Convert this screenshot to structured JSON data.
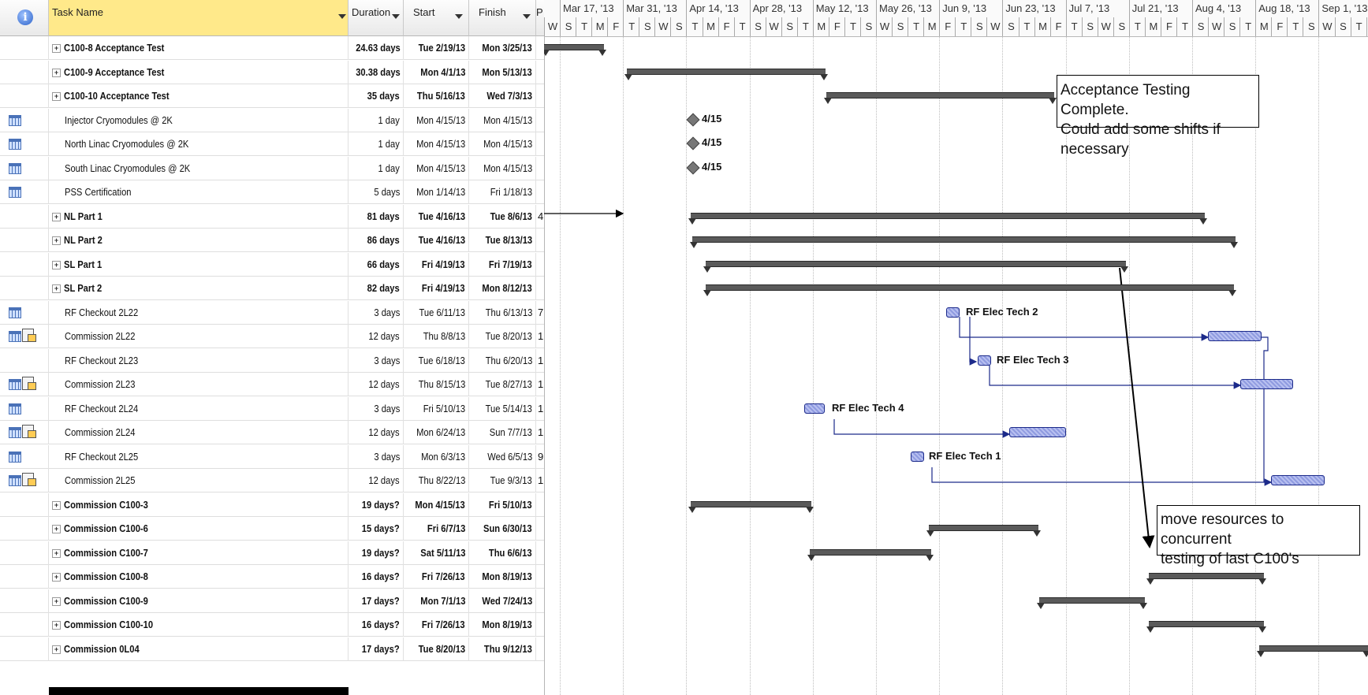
{
  "header": {
    "task_name": "Task Name",
    "duration": "Duration",
    "start": "Start",
    "finish": "Finish",
    "pred": "P"
  },
  "timescale": {
    "weeks": [
      "Mar 17, '13",
      "Mar 31, '13",
      "Apr 14, '13",
      "Apr 28, '13",
      "May 12, '13",
      "May 26, '13",
      "Jun 9, '13",
      "Jun 23, '13",
      "Jul 7, '13",
      "Jul 21, '13",
      "Aug 4, '13",
      "Aug 18, '13",
      "Sep 1, '13"
    ],
    "days": [
      "W",
      "S",
      "T",
      "M",
      "F",
      "T",
      "S",
      "W",
      "S",
      "T",
      "M",
      "F",
      "T",
      "S",
      "W",
      "S",
      "T",
      "M",
      "F",
      "T",
      "S",
      "W",
      "S",
      "T",
      "M",
      "F",
      "T",
      "S",
      "W",
      "S",
      "T",
      "M",
      "F",
      "T",
      "S",
      "W",
      "S",
      "T",
      "M",
      "F",
      "T",
      "S",
      "W",
      "S",
      "T",
      "M",
      "F",
      "T",
      "S",
      "W",
      "S",
      "T",
      "M"
    ]
  },
  "tasks": [
    {
      "name": "C100-8 Acceptance Test",
      "dur": "24.63 days",
      "start": "Tue 2/19/13",
      "finish": "Mon 3/25/13",
      "pred": "",
      "bold": true,
      "summary": true,
      "icon": ""
    },
    {
      "name": "C100-9 Acceptance Test",
      "dur": "30.38 days",
      "start": "Mon 4/1/13",
      "finish": "Mon 5/13/13",
      "pred": "",
      "bold": true,
      "summary": true,
      "icon": ""
    },
    {
      "name": "C100-10 Acceptance Test",
      "dur": "35 days",
      "start": "Thu 5/16/13",
      "finish": "Wed 7/3/13",
      "pred": "",
      "bold": true,
      "summary": true,
      "icon": ""
    },
    {
      "name": "Injector Cryomodules @ 2K",
      "dur": "1 day",
      "start": "Mon 4/15/13",
      "finish": "Mon 4/15/13",
      "pred": "",
      "bold": false,
      "summary": false,
      "icon": "cal"
    },
    {
      "name": "North Linac Cryomodules @ 2K",
      "dur": "1 day",
      "start": "Mon 4/15/13",
      "finish": "Mon 4/15/13",
      "pred": "",
      "bold": false,
      "summary": false,
      "icon": "cal"
    },
    {
      "name": "South Linac Cryomodules @ 2K",
      "dur": "1 day",
      "start": "Mon 4/15/13",
      "finish": "Mon 4/15/13",
      "pred": "",
      "bold": false,
      "summary": false,
      "icon": "cal"
    },
    {
      "name": "PSS Certification",
      "dur": "5 days",
      "start": "Mon 1/14/13",
      "finish": "Fri 1/18/13",
      "pred": "",
      "bold": false,
      "summary": false,
      "icon": "cal"
    },
    {
      "name": "NL Part 1",
      "dur": "81 days",
      "start": "Tue 4/16/13",
      "finish": "Tue 8/6/13",
      "pred": "4",
      "bold": true,
      "summary": true,
      "icon": ""
    },
    {
      "name": "NL Part 2",
      "dur": "86 days",
      "start": "Tue 4/16/13",
      "finish": "Tue 8/13/13",
      "pred": "",
      "bold": true,
      "summary": true,
      "icon": ""
    },
    {
      "name": "SL Part 1",
      "dur": "66 days",
      "start": "Fri 4/19/13",
      "finish": "Fri 7/19/13",
      "pred": "",
      "bold": true,
      "summary": true,
      "icon": ""
    },
    {
      "name": "SL Part 2",
      "dur": "82 days",
      "start": "Fri 4/19/13",
      "finish": "Mon 8/12/13",
      "pred": "",
      "bold": true,
      "summary": true,
      "icon": ""
    },
    {
      "name": "RF Checkout 2L22",
      "dur": "3 days",
      "start": "Tue 6/11/13",
      "finish": "Thu 6/13/13",
      "pred": "7",
      "bold": false,
      "summary": false,
      "icon": "cal"
    },
    {
      "name": "Commission 2L22",
      "dur": "12 days",
      "start": "Thu 8/8/13",
      "finish": "Tue 8/20/13",
      "pred": "1",
      "bold": false,
      "summary": false,
      "icon": "calres"
    },
    {
      "name": "RF Checkout 2L23",
      "dur": "3 days",
      "start": "Tue 6/18/13",
      "finish": "Thu 6/20/13",
      "pred": "1",
      "bold": false,
      "summary": false,
      "icon": ""
    },
    {
      "name": "Commission 2L23",
      "dur": "12 days",
      "start": "Thu 8/15/13",
      "finish": "Tue 8/27/13",
      "pred": "1",
      "bold": false,
      "summary": false,
      "icon": "calres"
    },
    {
      "name": "RF Checkout 2L24",
      "dur": "3 days",
      "start": "Fri 5/10/13",
      "finish": "Tue 5/14/13",
      "pred": "1",
      "bold": false,
      "summary": false,
      "icon": "cal"
    },
    {
      "name": "Commission 2L24",
      "dur": "12 days",
      "start": "Mon 6/24/13",
      "finish": "Sun 7/7/13",
      "pred": "1",
      "bold": false,
      "summary": false,
      "icon": "calres"
    },
    {
      "name": "RF Checkout 2L25",
      "dur": "3 days",
      "start": "Mon 6/3/13",
      "finish": "Wed 6/5/13",
      "pred": "9",
      "bold": false,
      "summary": false,
      "icon": "cal"
    },
    {
      "name": "Commission 2L25",
      "dur": "12 days",
      "start": "Thu 8/22/13",
      "finish": "Tue 9/3/13",
      "pred": "1",
      "bold": false,
      "summary": false,
      "icon": "calres"
    },
    {
      "name": "Commission C100-3",
      "dur": "19 days?",
      "start": "Mon 4/15/13",
      "finish": "Fri 5/10/13",
      "pred": "",
      "bold": true,
      "summary": true,
      "icon": ""
    },
    {
      "name": "Commission C100-6",
      "dur": "15 days?",
      "start": "Fri 6/7/13",
      "finish": "Sun 6/30/13",
      "pred": "",
      "bold": true,
      "summary": true,
      "icon": ""
    },
    {
      "name": "Commission C100-7",
      "dur": "19 days?",
      "start": "Sat 5/11/13",
      "finish": "Thu 6/6/13",
      "pred": "",
      "bold": true,
      "summary": true,
      "icon": ""
    },
    {
      "name": "Commission C100-8",
      "dur": "16 days?",
      "start": "Fri 7/26/13",
      "finish": "Mon 8/19/13",
      "pred": "",
      "bold": true,
      "summary": true,
      "icon": ""
    },
    {
      "name": "Commission C100-9",
      "dur": "17 days?",
      "start": "Mon 7/1/13",
      "finish": "Wed 7/24/13",
      "pred": "",
      "bold": true,
      "summary": true,
      "icon": ""
    },
    {
      "name": "Commission C100-10",
      "dur": "16 days?",
      "start": "Fri 7/26/13",
      "finish": "Mon 8/19/13",
      "pred": "",
      "bold": true,
      "summary": true,
      "icon": ""
    },
    {
      "name": "Commission 0L04",
      "dur": "17 days?",
      "start": "Tue 8/20/13",
      "finish": "Thu 9/12/13",
      "pred": "",
      "bold": true,
      "summary": true,
      "icon": ""
    }
  ],
  "milestone_labels": [
    "4/15",
    "4/15",
    "4/15"
  ],
  "resource_labels": {
    "tech2": "RF Elec Tech 2",
    "tech3": "RF Elec Tech 3",
    "tech4": "RF Elec Tech 4",
    "tech1": "RF Elec Tech 1"
  },
  "notes": {
    "note1_line1": "Acceptance Testing Complete.",
    "note1_line2": "Could add some shifts if necessary",
    "note2_line1": "move resources to concurrent",
    "note2_line2": "testing of last C100's"
  }
}
